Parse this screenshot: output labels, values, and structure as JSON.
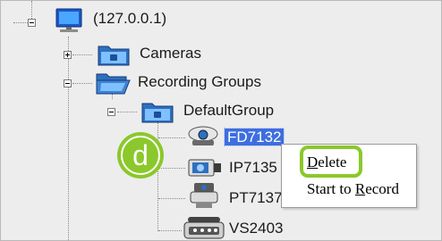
{
  "tree": {
    "root": {
      "label": "(127.0.0.1)",
      "icon": "monitor-icon"
    },
    "cameras": {
      "label": "Cameras",
      "icon": "folder-icon"
    },
    "recording_groups": {
      "label": "Recording Groups",
      "icon": "open-folder-icon"
    },
    "default_group": {
      "label": "DefaultGroup",
      "icon": "folder-icon"
    },
    "devices": [
      {
        "label": "FD7132",
        "icon": "dome-camera-icon",
        "selected": true
      },
      {
        "label": "IP7135",
        "icon": "box-camera-icon",
        "selected": false
      },
      {
        "label": "PT7137",
        "icon": "ptz-camera-icon",
        "selected": false
      },
      {
        "label": "VS2403",
        "icon": "video-server-icon",
        "selected": false
      }
    ]
  },
  "callout": {
    "letter": "d",
    "color": "#8bc82b"
  },
  "context_menu": {
    "items": [
      {
        "label": "Delete",
        "accel": "D"
      },
      {
        "label": "Start to Record",
        "accel": "R"
      }
    ]
  },
  "colors": {
    "selection": "#3d6ee0",
    "highlight": "#8bc82b",
    "folder": "#2f7fd0"
  }
}
